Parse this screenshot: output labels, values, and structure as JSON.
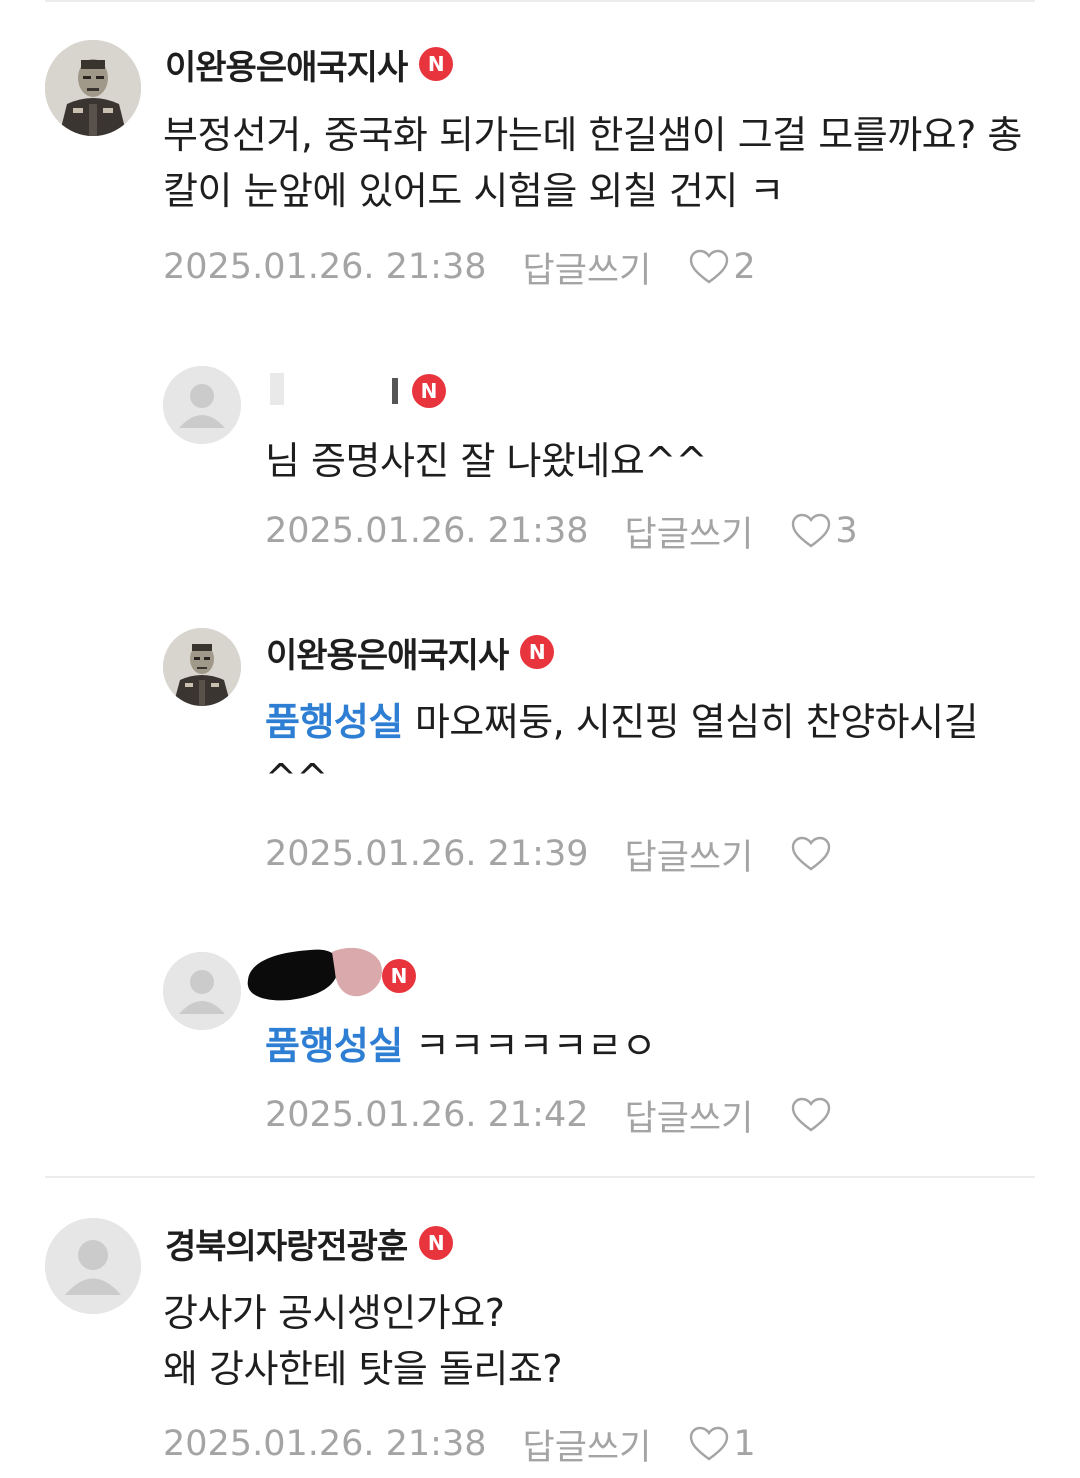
{
  "comments": [
    {
      "nickname": "이완용은애국지사",
      "badge": "N",
      "text": "부정선거, 중국화 되가는데 한길샘이 그걸 모를까요? 총칼이 눈앞에 있어도 시험을 외칠 건지 ㅋ",
      "timestamp": "2025.01.26. 21:38",
      "reply_label": "답글쓰기",
      "likes": "2",
      "avatar": "portrait-photo"
    },
    {
      "nickname": "",
      "badge": "N",
      "text": "님 증명사진 잘 나왔네요^^",
      "timestamp": "2025.01.26. 21:38",
      "reply_label": "답글쓰기",
      "likes": "3",
      "avatar": "default-avatar"
    },
    {
      "nickname": "이완용은애국지사",
      "badge": "N",
      "mention": "품행성실",
      "text": "마오쩌둥, 시진핑 열심히 찬양하시길 ^^",
      "timestamp": "2025.01.26. 21:39",
      "reply_label": "답글쓰기",
      "likes": "",
      "avatar": "portrait-photo"
    },
    {
      "nickname": "",
      "badge": "N",
      "mention": "품행성실",
      "text": "ㅋㅋㅋㅋㅋㄹㅇ",
      "timestamp": "2025.01.26. 21:42",
      "reply_label": "답글쓰기",
      "likes": "",
      "avatar": "default-avatar"
    },
    {
      "nickname": "경북의자랑전광훈",
      "badge": "N",
      "text_lines": [
        "강사가 공시생인가요?",
        "왜 강사한테 탓을 돌리죠?"
      ],
      "timestamp": "2025.01.26. 21:38",
      "reply_label": "답글쓰기",
      "likes": "1",
      "avatar": "default-avatar"
    }
  ],
  "colors": {
    "mention": "#2e7fd3",
    "badge": "#e8343d",
    "meta": "#a4a4a4",
    "text": "#1e1e1e"
  }
}
